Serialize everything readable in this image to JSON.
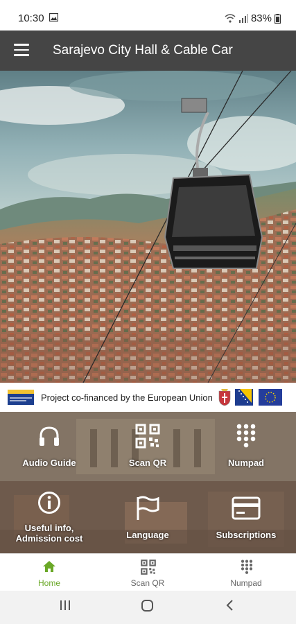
{
  "status": {
    "time": "10:30",
    "battery": "83%"
  },
  "app_bar": {
    "title": "Sarajevo City Hall & Cable Car",
    "menu_icon": "hamburger-menu-icon"
  },
  "banner": {
    "text": "Project co-financed by the European Union"
  },
  "tiles": [
    {
      "label": "Audio Guide",
      "icon": "headphones-icon"
    },
    {
      "label": "Scan QR",
      "icon": "qr-code-icon"
    },
    {
      "label": "Numpad",
      "icon": "numpad-icon"
    },
    {
      "label_line1": "Useful info,",
      "label_line2": "Admission cost",
      "icon": "info-icon"
    },
    {
      "label": "Language",
      "icon": "flag-icon"
    },
    {
      "label": "Subscriptions",
      "icon": "card-icon"
    }
  ],
  "bottom_nav": {
    "items": [
      {
        "label": "Home",
        "icon": "home-icon",
        "active": true
      },
      {
        "label": "Scan QR",
        "icon": "qr-code-icon",
        "active": false
      },
      {
        "label": "Numpad",
        "icon": "numpad-icon",
        "active": false
      }
    ]
  },
  "colors": {
    "active": "#6aa827",
    "inactive": "#666666",
    "app_bar": "#4b4b4b"
  }
}
